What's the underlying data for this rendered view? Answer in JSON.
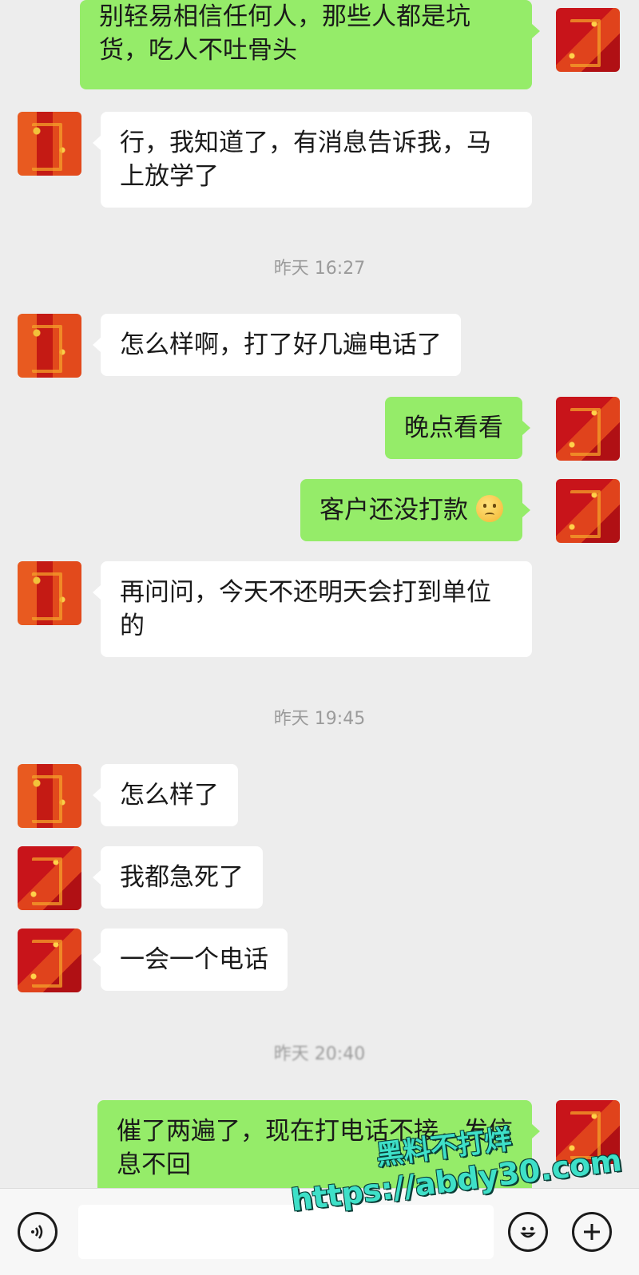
{
  "messages": [
    {
      "side": "out",
      "text": "别轻易相信任何人，那些人都是坑货，吃人不吐骨头"
    },
    {
      "side": "in",
      "text": "行，我知道了，有消息告诉我，马上放学了"
    },
    {
      "type": "timestamp",
      "text": "昨天 16:27"
    },
    {
      "side": "in",
      "text": "怎么样啊，打了好几遍电话了"
    },
    {
      "side": "out",
      "text": "晚点看看"
    },
    {
      "side": "out",
      "text": "客户还没打款",
      "emoji": "pleading-face-emoji"
    },
    {
      "side": "in",
      "text": "再问问，今天不还明天会打到单位的"
    },
    {
      "type": "timestamp",
      "text": "昨天 19:45"
    },
    {
      "side": "in",
      "text": "怎么样了"
    },
    {
      "side": "in",
      "text": "我都急死了"
    },
    {
      "side": "in",
      "text": "一会一个电话"
    },
    {
      "type": "timestamp",
      "text": "昨天 20:40"
    },
    {
      "side": "out",
      "text": "催了两遍了，现在打电话不接，发信息不回"
    }
  ],
  "input_bar": {
    "voice_icon": "voice-icon",
    "emoji_icon": "emoji-icon",
    "add_icon": "plus-icon"
  },
  "watermark": {
    "line1": "黑料不打烊",
    "line2": "https://abdy30.com",
    "color": "#3ee0c8"
  },
  "colors": {
    "background": "#ededed",
    "outgoing_bubble": "#95ec69",
    "incoming_bubble": "#ffffff"
  }
}
